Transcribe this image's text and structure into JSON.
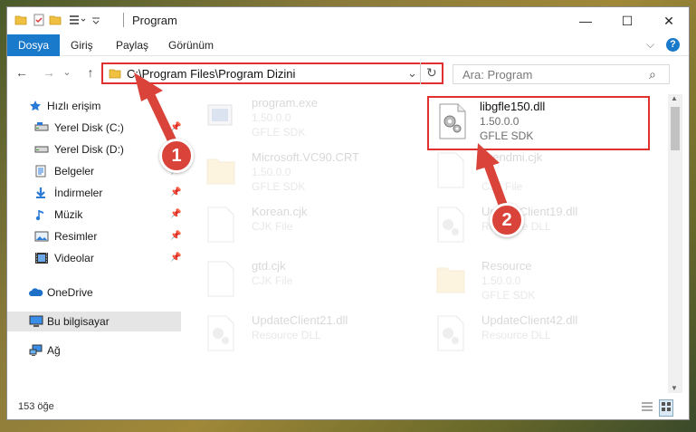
{
  "window": {
    "title": "Program",
    "minimize": "—",
    "maximize": "☐",
    "close": "✕"
  },
  "ribbon": {
    "tabs": [
      {
        "label": "Dosya",
        "active": true
      },
      {
        "label": "Giriş"
      },
      {
        "label": "Paylaş"
      },
      {
        "label": "Görünüm"
      }
    ],
    "expand": "⌵",
    "help": "?"
  },
  "nav": {
    "back": "←",
    "forward": "→",
    "dropdown": "⌄",
    "up": "↑",
    "address": "C:\\Program Files\\Program Dizini",
    "address_dropdown": "⌄",
    "refresh": "↻",
    "search_placeholder": "Ara: Program",
    "search_icon": "⌕"
  },
  "sidebar": {
    "items": [
      {
        "label": "Hızlı erişim",
        "icon": "star-icon"
      },
      {
        "label": "Yerel Disk (C:)",
        "icon": "drive-icon",
        "pinned": true
      },
      {
        "label": "Yerel Disk (D:)",
        "icon": "drive-icon",
        "pinned": true
      },
      {
        "label": "Belgeler",
        "icon": "documents-icon",
        "pinned": true
      },
      {
        "label": "İndirmeler",
        "icon": "download-icon",
        "pinned": true
      },
      {
        "label": "Müzik",
        "icon": "music-icon",
        "pinned": true
      },
      {
        "label": "Resimler",
        "icon": "pictures-icon",
        "pinned": true
      },
      {
        "label": "Videolar",
        "icon": "videos-icon",
        "pinned": true
      },
      {
        "label": "OneDrive",
        "icon": "cloud-icon"
      },
      {
        "label": "Bu bilgisayar",
        "icon": "computer-icon",
        "selected": true
      },
      {
        "label": "Ağ",
        "icon": "network-icon"
      }
    ]
  },
  "files": [
    {
      "name": "program.exe",
      "version": "1.50.0.0",
      "type": "GFLE SDK",
      "icon": "exe-icon"
    },
    {
      "name": "libgfle150.dll",
      "version": "1.50.0.0",
      "type": "GFLE SDK",
      "icon": "dll-icon",
      "highlighted": true
    },
    {
      "name": "Microsoft.VC90.CRT",
      "version": "1.50.0.0",
      "type": "GFLE SDK",
      "icon": "folder-icon"
    },
    {
      "name": "Frendmi.cjk",
      "version": "",
      "type": "CJK File",
      "icon": "file-icon"
    },
    {
      "name": "Korean.cjk",
      "version": "",
      "type": "CJK File",
      "icon": "file-icon"
    },
    {
      "name": "UpdateClient19.dll",
      "version": "",
      "type": "Resource DLL",
      "icon": "dll-icon"
    },
    {
      "name": "gtd.cjk",
      "version": "",
      "type": "CJK File",
      "icon": "file-icon"
    },
    {
      "name": "Resource",
      "version": "1.50.0.0",
      "type": "GFLE SDK",
      "icon": "folder-icon"
    },
    {
      "name": "UpdateClient21.dll",
      "version": "",
      "type": "Resource DLL",
      "icon": "dll-icon"
    },
    {
      "name": "UpdateClient42.dll",
      "version": "",
      "type": "Resource DLL",
      "icon": "dll-icon"
    }
  ],
  "status": {
    "count": "153 öğe"
  },
  "callouts": [
    "1",
    "2"
  ],
  "colors": {
    "accent": "#1979ca",
    "callout": "#d9433a",
    "highlight_border": "#e03030"
  }
}
